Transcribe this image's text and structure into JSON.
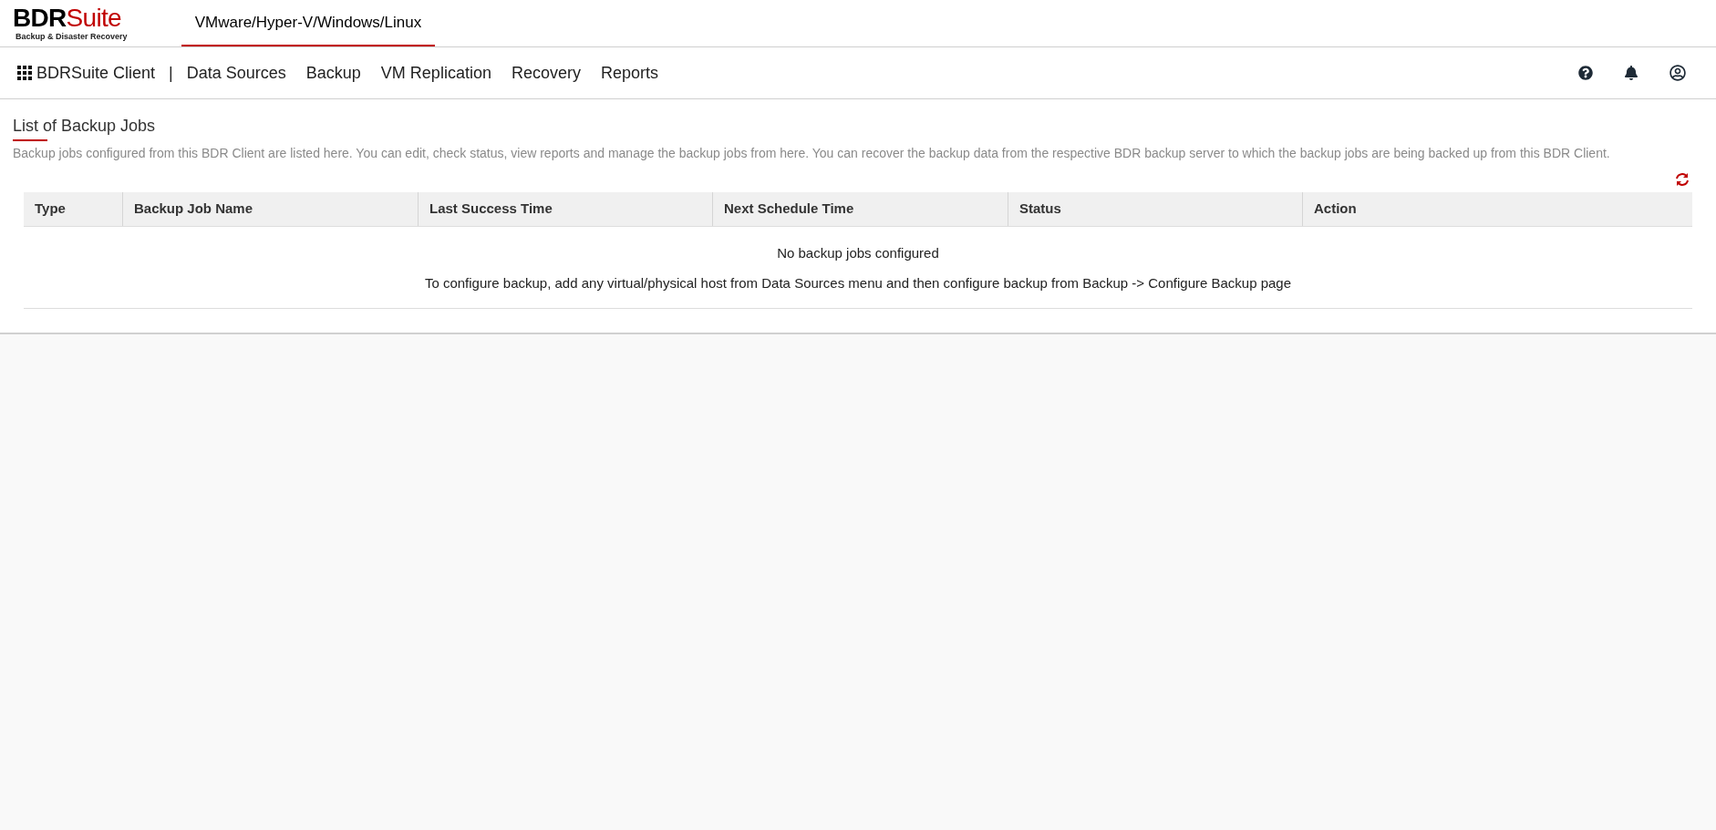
{
  "logo": {
    "brand_dark": "BDR",
    "brand_accent": "Suite",
    "tagline": "Backup & Disaster Recovery"
  },
  "top_tabs": [
    {
      "label": "VMware/Hyper-V/Windows/Linux",
      "selected": true
    }
  ],
  "nav": {
    "app_name": "BDRSuite Client",
    "separator": "|",
    "items": [
      {
        "label": "Data Sources"
      },
      {
        "label": "Backup"
      },
      {
        "label": "VM Replication"
      },
      {
        "label": "Recovery"
      },
      {
        "label": "Reports"
      }
    ]
  },
  "page": {
    "title": "List of Backup Jobs",
    "description": "Backup jobs configured from this BDR Client are listed here. You can edit, check status, view reports and manage the backup jobs from here. You can recover the backup data from the respective BDR backup server to which the backup jobs are being backed up from this BDR Client."
  },
  "table": {
    "columns": [
      "Type",
      "Backup Job Name",
      "Last Success Time",
      "Next Schedule Time",
      "Status",
      "Action"
    ],
    "empty_title": "No backup jobs configured",
    "empty_hint": "To configure backup, add any virtual/physical host from Data Sources menu and then configure backup from Backup -> Configure Backup page"
  }
}
